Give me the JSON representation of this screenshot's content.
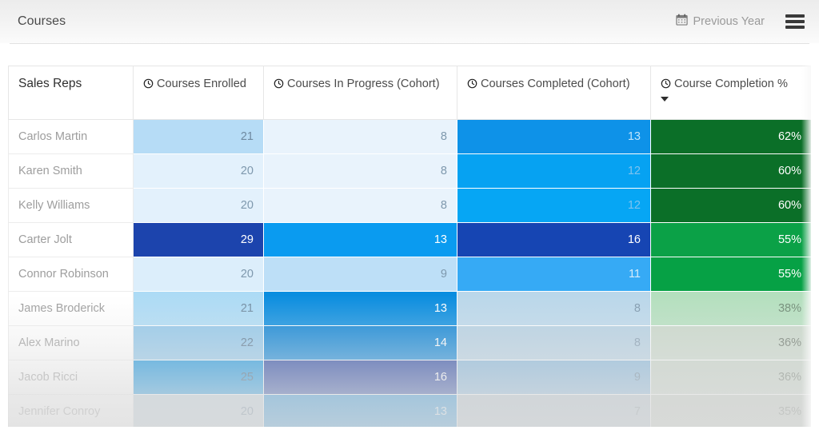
{
  "header": {
    "title": "Courses",
    "calendar_icon": "calendar-icon",
    "year_filter_label": "Previous Year",
    "menu_icon": "hamburger-menu-icon"
  },
  "table": {
    "columns": [
      {
        "id": "rep",
        "label": "Sales Reps",
        "icon": null,
        "sorted": false
      },
      {
        "id": "enrolled",
        "label": "Courses Enrolled",
        "icon": "clock-icon",
        "sorted": false
      },
      {
        "id": "inprogress",
        "label": "Courses In Progress (Cohort)",
        "icon": "clock-icon",
        "sorted": false
      },
      {
        "id": "completed",
        "label": "Courses Completed (Cohort)",
        "icon": "clock-icon",
        "sorted": false
      },
      {
        "id": "completion",
        "label": "Course Completion %",
        "icon": "clock-icon",
        "sorted": true,
        "sort_direction": "desc",
        "sort_icon": "caret-down-icon"
      }
    ],
    "rows": [
      {
        "rep": "Carlos Martin",
        "enrolled": "21",
        "inprogress": "8",
        "completed": "13",
        "completion": "62%",
        "colors": {
          "enrolled": "#b6dcf6",
          "inprogress": "#e9f3fc",
          "completed": "#0e92e8",
          "completion": "#0b6f28"
        },
        "text": {
          "enrolled": "#6f8aa0",
          "inprogress": "#7e98ad",
          "completed": "#bfe4fb",
          "completion": "#ffffff"
        }
      },
      {
        "rep": "Karen Smith",
        "enrolled": "20",
        "inprogress": "8",
        "completed": "12",
        "completion": "60%",
        "colors": {
          "enrolled": "#e3f1fc",
          "inprogress": "#e9f3fc",
          "completed": "#06a2f2",
          "completion": "#0b6f28"
        },
        "text": {
          "enrolled": "#7e98ad",
          "inprogress": "#7e98ad",
          "completed": "#7ec3ef",
          "completion": "#ffffff"
        }
      },
      {
        "rep": "Kelly Williams",
        "enrolled": "20",
        "inprogress": "8",
        "completed": "12",
        "completion": "60%",
        "colors": {
          "enrolled": "#e3f1fc",
          "inprogress": "#e9f3fc",
          "completed": "#06a6f4",
          "completion": "#0b6f28"
        },
        "text": {
          "enrolled": "#7e98ad",
          "inprogress": "#7e98ad",
          "completed": "#7ec3ef",
          "completion": "#ffffff"
        }
      },
      {
        "rep": "Carter Jolt",
        "enrolled": "29",
        "inprogress": "13",
        "completed": "16",
        "completion": "55%",
        "colors": {
          "enrolled": "#1c44ad",
          "inprogress": "#0a9bf0",
          "completed": "#1645b3",
          "completion": "#0ba147"
        },
        "text": {
          "enrolled": "#ffffff",
          "inprogress": "#ffffff",
          "completed": "#ffffff",
          "completion": "#ffffff"
        }
      },
      {
        "rep": "Connor Robinson",
        "enrolled": "20",
        "inprogress": "9",
        "completed": "11",
        "completion": "55%",
        "colors": {
          "enrolled": "#dceefb",
          "inprogress": "#bddff7",
          "completed": "#36aaf5",
          "completion": "#06a145"
        },
        "text": {
          "enrolled": "#7e98ad",
          "inprogress": "#7e98ad",
          "completed": "#d6ecfb",
          "completion": "#ffffff"
        }
      },
      {
        "rep": "James Broderick",
        "enrolled": "21",
        "inprogress": "13",
        "completed": "8",
        "completion": "38%",
        "colors": {
          "enrolled": "#addbf5",
          "inprogress": "#0a8ddf",
          "completed": "#bad7ea",
          "completion": "#b4dfbe"
        },
        "text": {
          "enrolled": "#6f8aa0",
          "inprogress": "#ffffff",
          "completed": "#7e98ad",
          "completion": "#6f8a74"
        }
      },
      {
        "rep": "Alex Marino",
        "enrolled": "22",
        "inprogress": "14",
        "completed": "8",
        "completion": "36%",
        "colors": {
          "enrolled": "#8fc6e9",
          "inprogress": "#0a82d4",
          "completed": "#b3cfe2",
          "completion": "#c7d6c8"
        },
        "text": {
          "enrolled": "#55738c",
          "inprogress": "#ffffff",
          "completed": "#7e98ad",
          "completion": "#6a766a"
        }
      },
      {
        "rep": "Jacob Ricci",
        "enrolled": "25",
        "inprogress": "16",
        "completed": "9",
        "completion": "36%",
        "colors": {
          "enrolled": "#0b8fdd",
          "inprogress": "#17379b",
          "completed": "#7eb2d8",
          "completion": "#c2d0c3"
        },
        "text": {
          "enrolled": "#2d4f6b",
          "inprogress": "#ffffff",
          "completed": "#5a7a93",
          "completion": "#6a766a"
        }
      },
      {
        "rep": "Jennifer Conroy",
        "enrolled": "20",
        "inprogress": "13",
        "completed": "7",
        "completion": "35%",
        "colors": {
          "enrolled": "#b6c9d6",
          "inprogress": "#0a82d0",
          "completed": "#aabcc7",
          "completion": "#bcc6bc"
        },
        "text": {
          "enrolled": "#55738c",
          "inprogress": "#cfe6f7",
          "completed": "#73858f",
          "completion": "#6a766a"
        }
      }
    ]
  },
  "chart_data": {
    "type": "heatmap",
    "title": "Courses",
    "categories": [
      "Carlos Martin",
      "Karen Smith",
      "Kelly Williams",
      "Carter Jolt",
      "Connor Robinson",
      "James Broderick",
      "Alex Marino",
      "Jacob Ricci",
      "Jennifer Conroy"
    ],
    "series": [
      {
        "name": "Courses Enrolled",
        "values": [
          21,
          20,
          20,
          29,
          20,
          21,
          22,
          25,
          20
        ]
      },
      {
        "name": "Courses In Progress (Cohort)",
        "values": [
          8,
          8,
          8,
          13,
          9,
          13,
          14,
          16,
          13
        ]
      },
      {
        "name": "Courses Completed (Cohort)",
        "values": [
          13,
          12,
          12,
          16,
          11,
          8,
          8,
          9,
          7
        ]
      },
      {
        "name": "Course Completion %",
        "values": [
          62,
          60,
          60,
          55,
          55,
          38,
          36,
          36,
          35
        ]
      }
    ],
    "xlabel": "Sales Reps",
    "ylabel": "",
    "sorted_by": "Course Completion %",
    "sort_direction": "desc",
    "legend": "none",
    "grid": true
  }
}
